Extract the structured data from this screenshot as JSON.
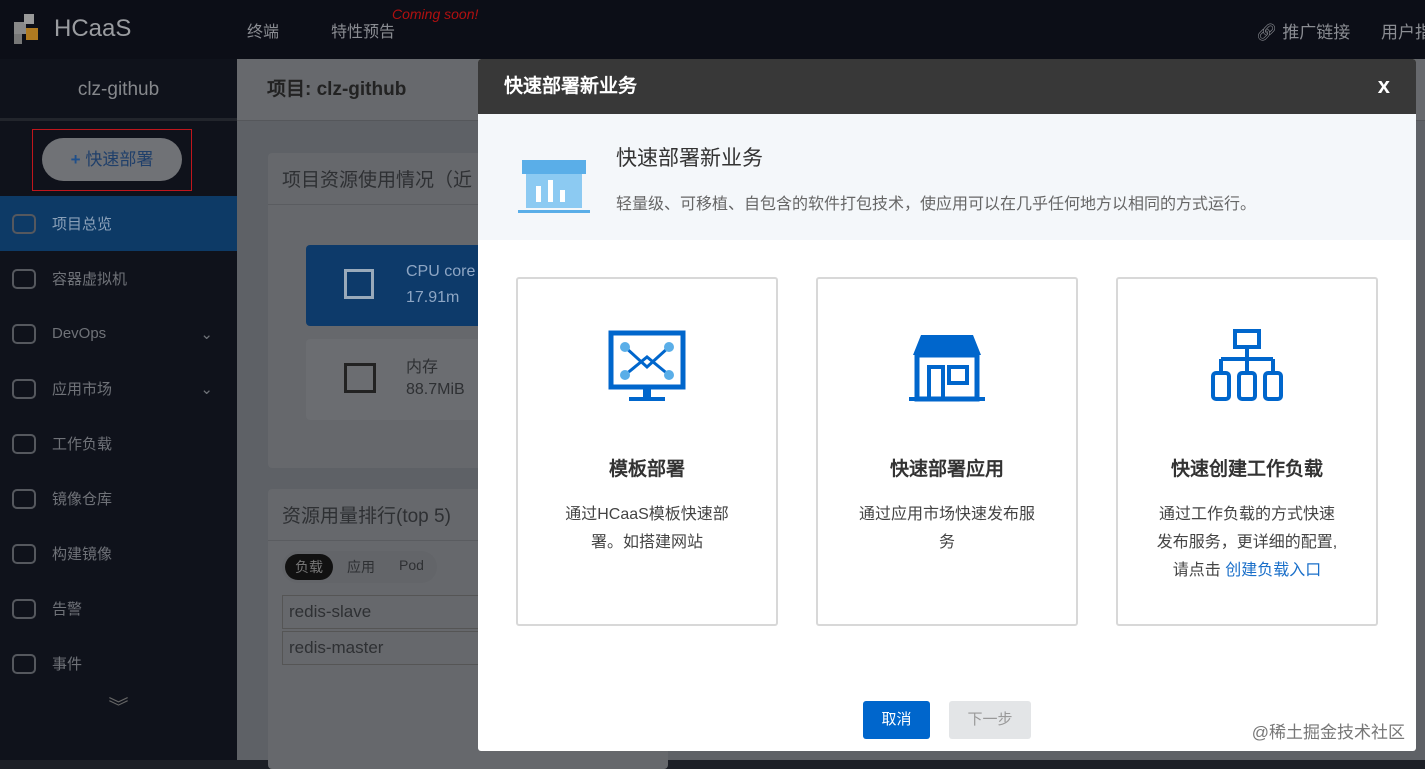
{
  "topbar": {
    "brand": "HCaaS",
    "nav": [
      "终端",
      "特性预告"
    ],
    "coming_soon": "Coming soon!",
    "promo_link": "推广链接",
    "user_guide": "用户指"
  },
  "sidebar": {
    "project": "clz-github",
    "quick_deploy": "快速部署",
    "items": [
      {
        "label": "项目总览",
        "active": true
      },
      {
        "label": "容器虚拟机"
      },
      {
        "label": "DevOps",
        "expand": true
      },
      {
        "label": "应用市场",
        "expand": true
      },
      {
        "label": "工作负载"
      },
      {
        "label": "镜像仓库"
      },
      {
        "label": "构建镜像"
      },
      {
        "label": "告警"
      },
      {
        "label": "事件"
      }
    ]
  },
  "main": {
    "title": "项目: clz-github",
    "usage_title": "项目资源使用情况（近",
    "cpu_label": "CPU core",
    "cpu_value": "17.91m",
    "mem_label": "内存",
    "mem_value": "88.7MiB",
    "rank_title": "资源用量排行(top 5)",
    "rank_tabs": [
      "负载",
      "应用",
      "Pod"
    ],
    "rank_rows": [
      "redis-slave",
      "redis-master"
    ]
  },
  "modal": {
    "title": "快速部署新业务",
    "intro_title": "快速部署新业务",
    "intro_desc": "轻量级、可移植、自包含的软件打包技术，使应用可以在几乎任何地方以相同的方式运行。",
    "options": [
      {
        "title": "模板部署",
        "desc": "通过HCaaS模板快速部署。如搭建网站"
      },
      {
        "title": "快速部署应用",
        "desc": "通过应用市场快速发布服务"
      },
      {
        "title": "快速创建工作负载",
        "desc": "通过工作负载的方式快速发布服务，更详细的配置,请点击 ",
        "link": "创建负载入口"
      }
    ],
    "cancel": "取消",
    "next": "下一步",
    "accent": "#0066cc"
  },
  "watermark": "@稀土掘金技术社区"
}
